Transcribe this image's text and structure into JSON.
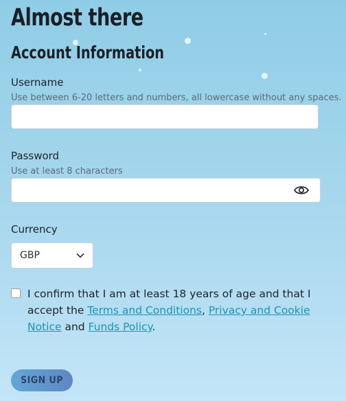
{
  "page": {
    "title": "Almost there",
    "section_title": "Account Information"
  },
  "form": {
    "username": {
      "label": "Username",
      "hint": "Use between 6-20 letters and numbers, all lowercase without any spaces.",
      "value": ""
    },
    "password": {
      "label": "Password",
      "hint": "Use at least 8 characters",
      "value": "",
      "toggle_icon": "eye-icon"
    },
    "currency": {
      "label": "Currency",
      "selected": "GBP",
      "icon": "chevron-down-icon"
    },
    "consent": {
      "text_before": "I confirm that I am at least 18 years of age and that I accept the ",
      "terms_link": "Terms and Conditions",
      "comma": ", ",
      "privacy_link": "Privacy and Cookie Notice",
      "and": " and ",
      "funds_link": "Funds Policy",
      "period": "."
    },
    "submit_label": "Sign up"
  },
  "colors": {
    "link": "#1c93b4",
    "button_start": "#62a7d6",
    "button_end": "#5f86c5"
  }
}
